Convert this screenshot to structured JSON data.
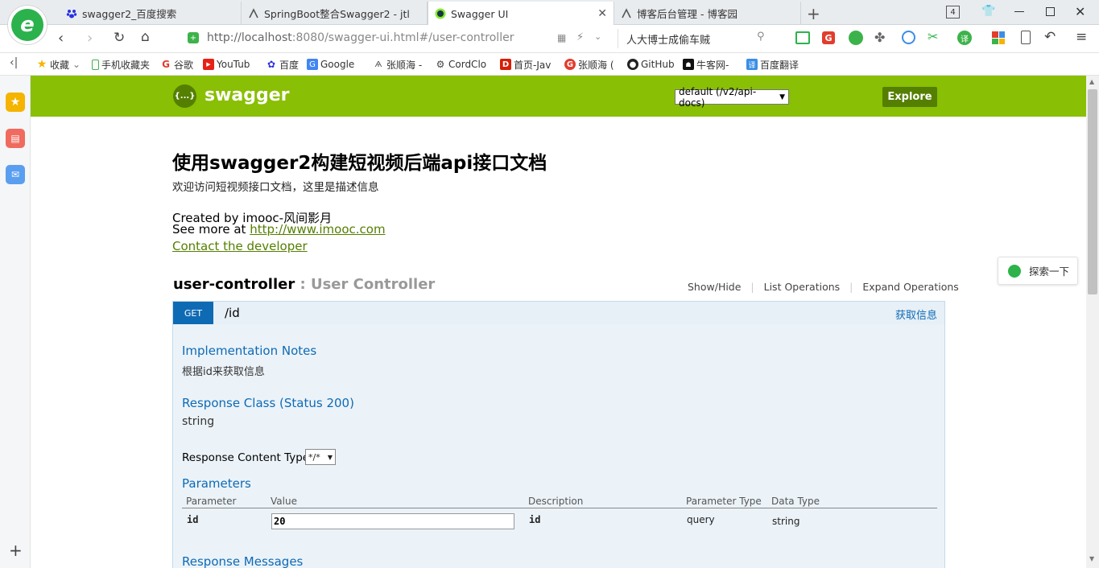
{
  "browser": {
    "tabs": [
      {
        "label": "swagger2_百度搜索",
        "active": false
      },
      {
        "label": "SpringBoot整合Swagger2 - jtl",
        "active": false
      },
      {
        "label": "Swagger UI",
        "active": true
      },
      {
        "label": "博客后台管理 - 博客园",
        "active": false
      }
    ],
    "tab_count": "4",
    "url_host": "http://localhost",
    "url_rest": ":8080/swagger-ui.html#/user-controller",
    "search_box_value": "人大博士成偷车贼",
    "bookmarks": [
      {
        "label": "收藏",
        "icon": "star-icon"
      },
      {
        "label": "手机收藏夹",
        "icon": "phone-icon"
      },
      {
        "label": "谷歌",
        "icon": "google-icon"
      },
      {
        "label": "YouTub",
        "icon": "youtube-icon"
      },
      {
        "label": "百度",
        "icon": "baidu-icon"
      },
      {
        "label": "Google",
        "icon": "google-translate-icon"
      },
      {
        "label": "张顺海 -",
        "icon": "csdn-icon"
      },
      {
        "label": "CordClo",
        "icon": "gear-icon"
      },
      {
        "label": "首页-Jav",
        "icon": "d-icon"
      },
      {
        "label": "张顺海 (",
        "icon": "g-red-icon"
      },
      {
        "label": "GitHub",
        "icon": "github-icon"
      },
      {
        "label": "牛客网-",
        "icon": "nowcoder-icon"
      },
      {
        "label": "百度翻译",
        "icon": "translate-icon"
      }
    ],
    "side_search": "探索一下"
  },
  "swagger": {
    "logo_text": "swagger",
    "logo_icon_text": "{...}",
    "api_select": "default (/v2/api-docs)",
    "explore_label": "Explore",
    "title": "使用swagger2构建短视频后端api接口文档",
    "description": "欢迎访问短视频接口文档，这里是描述信息",
    "created_by": "Created by imooc-风间影月",
    "see_more_prefix": "See more at ",
    "see_more_link": "http://www.imooc.com",
    "contact": "Contact the developer",
    "controller": {
      "name": "user-controller",
      "desc": " : User Controller",
      "actions": [
        "Show/Hide",
        "List Operations",
        "Expand Operations"
      ]
    },
    "operation": {
      "method": "GET",
      "path": "/id",
      "summary": "获取信息",
      "impl_notes_title": "Implementation Notes",
      "impl_notes": "根据id来获取信息",
      "response_class_title": "Response Class (Status 200)",
      "response_class": "string",
      "content_type_label": "Response Content Type",
      "content_type_value": "*/*",
      "parameters_title": "Parameters",
      "param_headers": [
        "Parameter",
        "Value",
        "Description",
        "Parameter Type",
        "Data Type"
      ],
      "params": [
        {
          "name": "id",
          "value": "20",
          "description": "id",
          "type": "query",
          "data_type": "string"
        }
      ],
      "response_messages_title": "Response Messages"
    }
  },
  "colors": {
    "swagger_green": "#89bf04",
    "explore_green": "#547f00",
    "get_blue": "#0f6ab4",
    "op_bg": "#e7f0f7"
  }
}
